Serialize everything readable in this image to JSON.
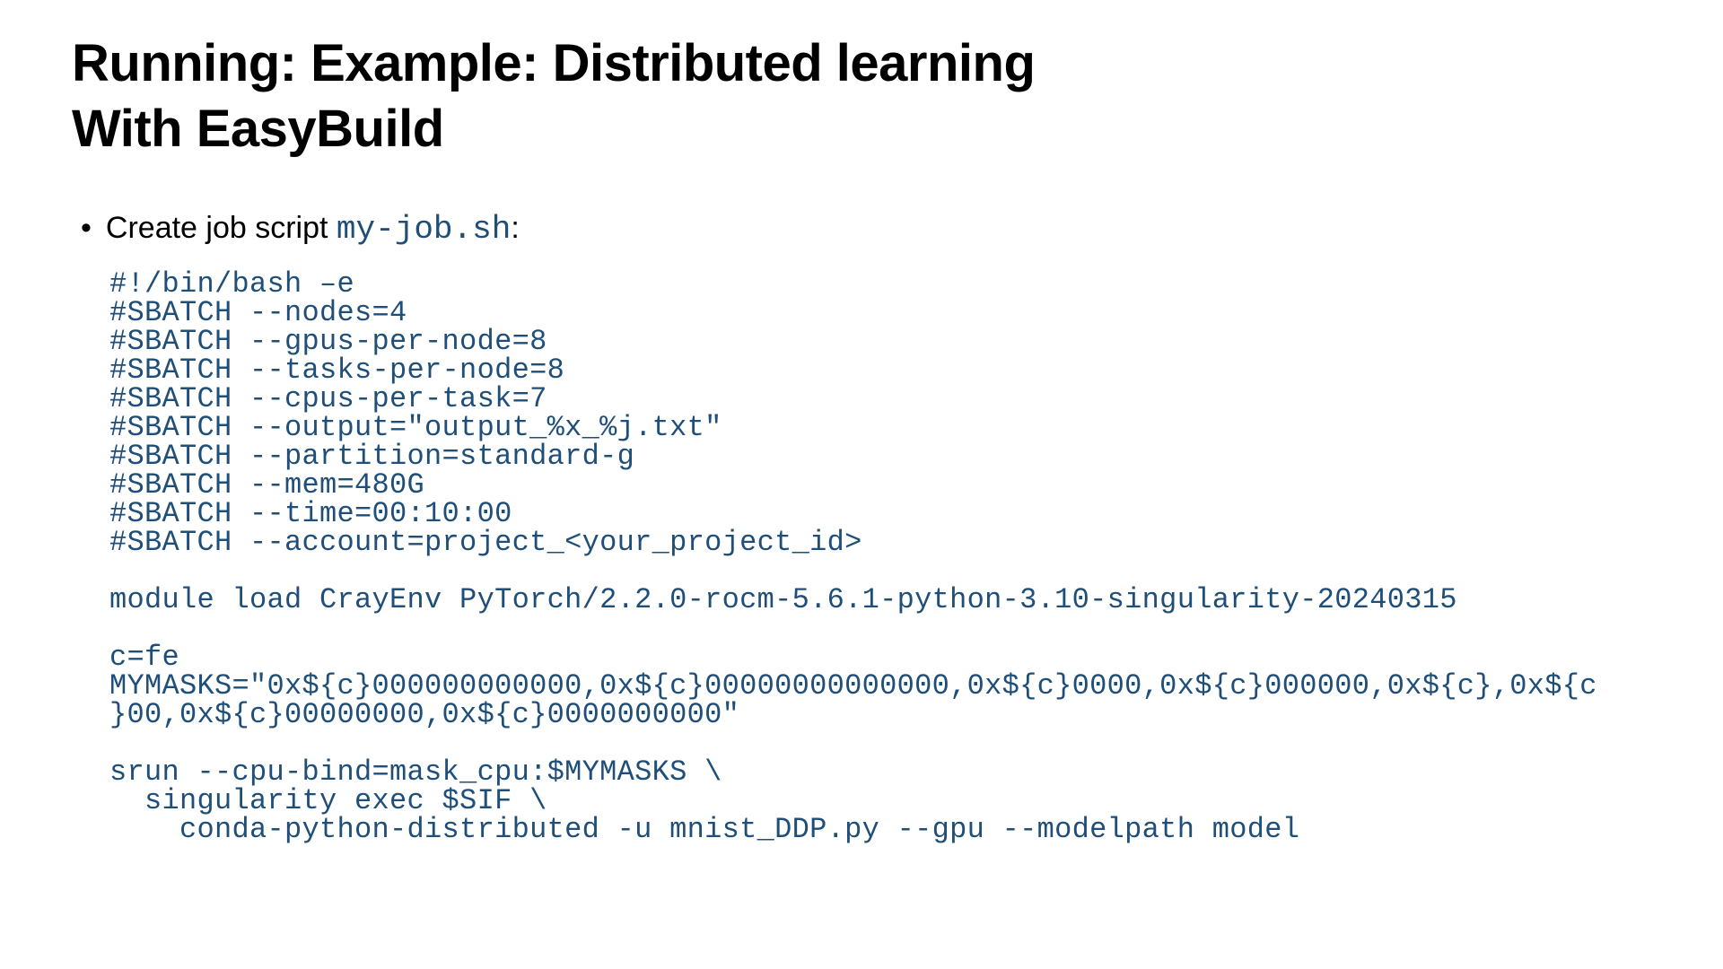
{
  "title_line1": "Running: Example: Distributed learning",
  "title_line2": "With EasyBuild",
  "bullet_prefix": "Create job script ",
  "filename": "my-job.sh",
  "bullet_suffix": ":",
  "code": "#!/bin/bash –e\n#SBATCH --nodes=4\n#SBATCH --gpus-per-node=8\n#SBATCH --tasks-per-node=8\n#SBATCH --cpus-per-task=7\n#SBATCH --output=\"output_%x_%j.txt\"\n#SBATCH --partition=standard-g\n#SBATCH --mem=480G\n#SBATCH --time=00:10:00\n#SBATCH --account=project_<your_project_id>\n\nmodule load CrayEnv PyTorch/2.2.0-rocm-5.6.1-python-3.10-singularity-20240315\n\nc=fe\nMYMASKS=\"0x${c}000000000000,0x${c}00000000000000,0x${c}0000,0x${c}000000,0x${c},0x${c\n}00,0x${c}00000000,0x${c}0000000000\"\n\nsrun --cpu-bind=mask_cpu:$MYMASKS \\\n  singularity exec $SIF \\\n    conda-python-distributed -u mnist_DDP.py --gpu --modelpath model"
}
